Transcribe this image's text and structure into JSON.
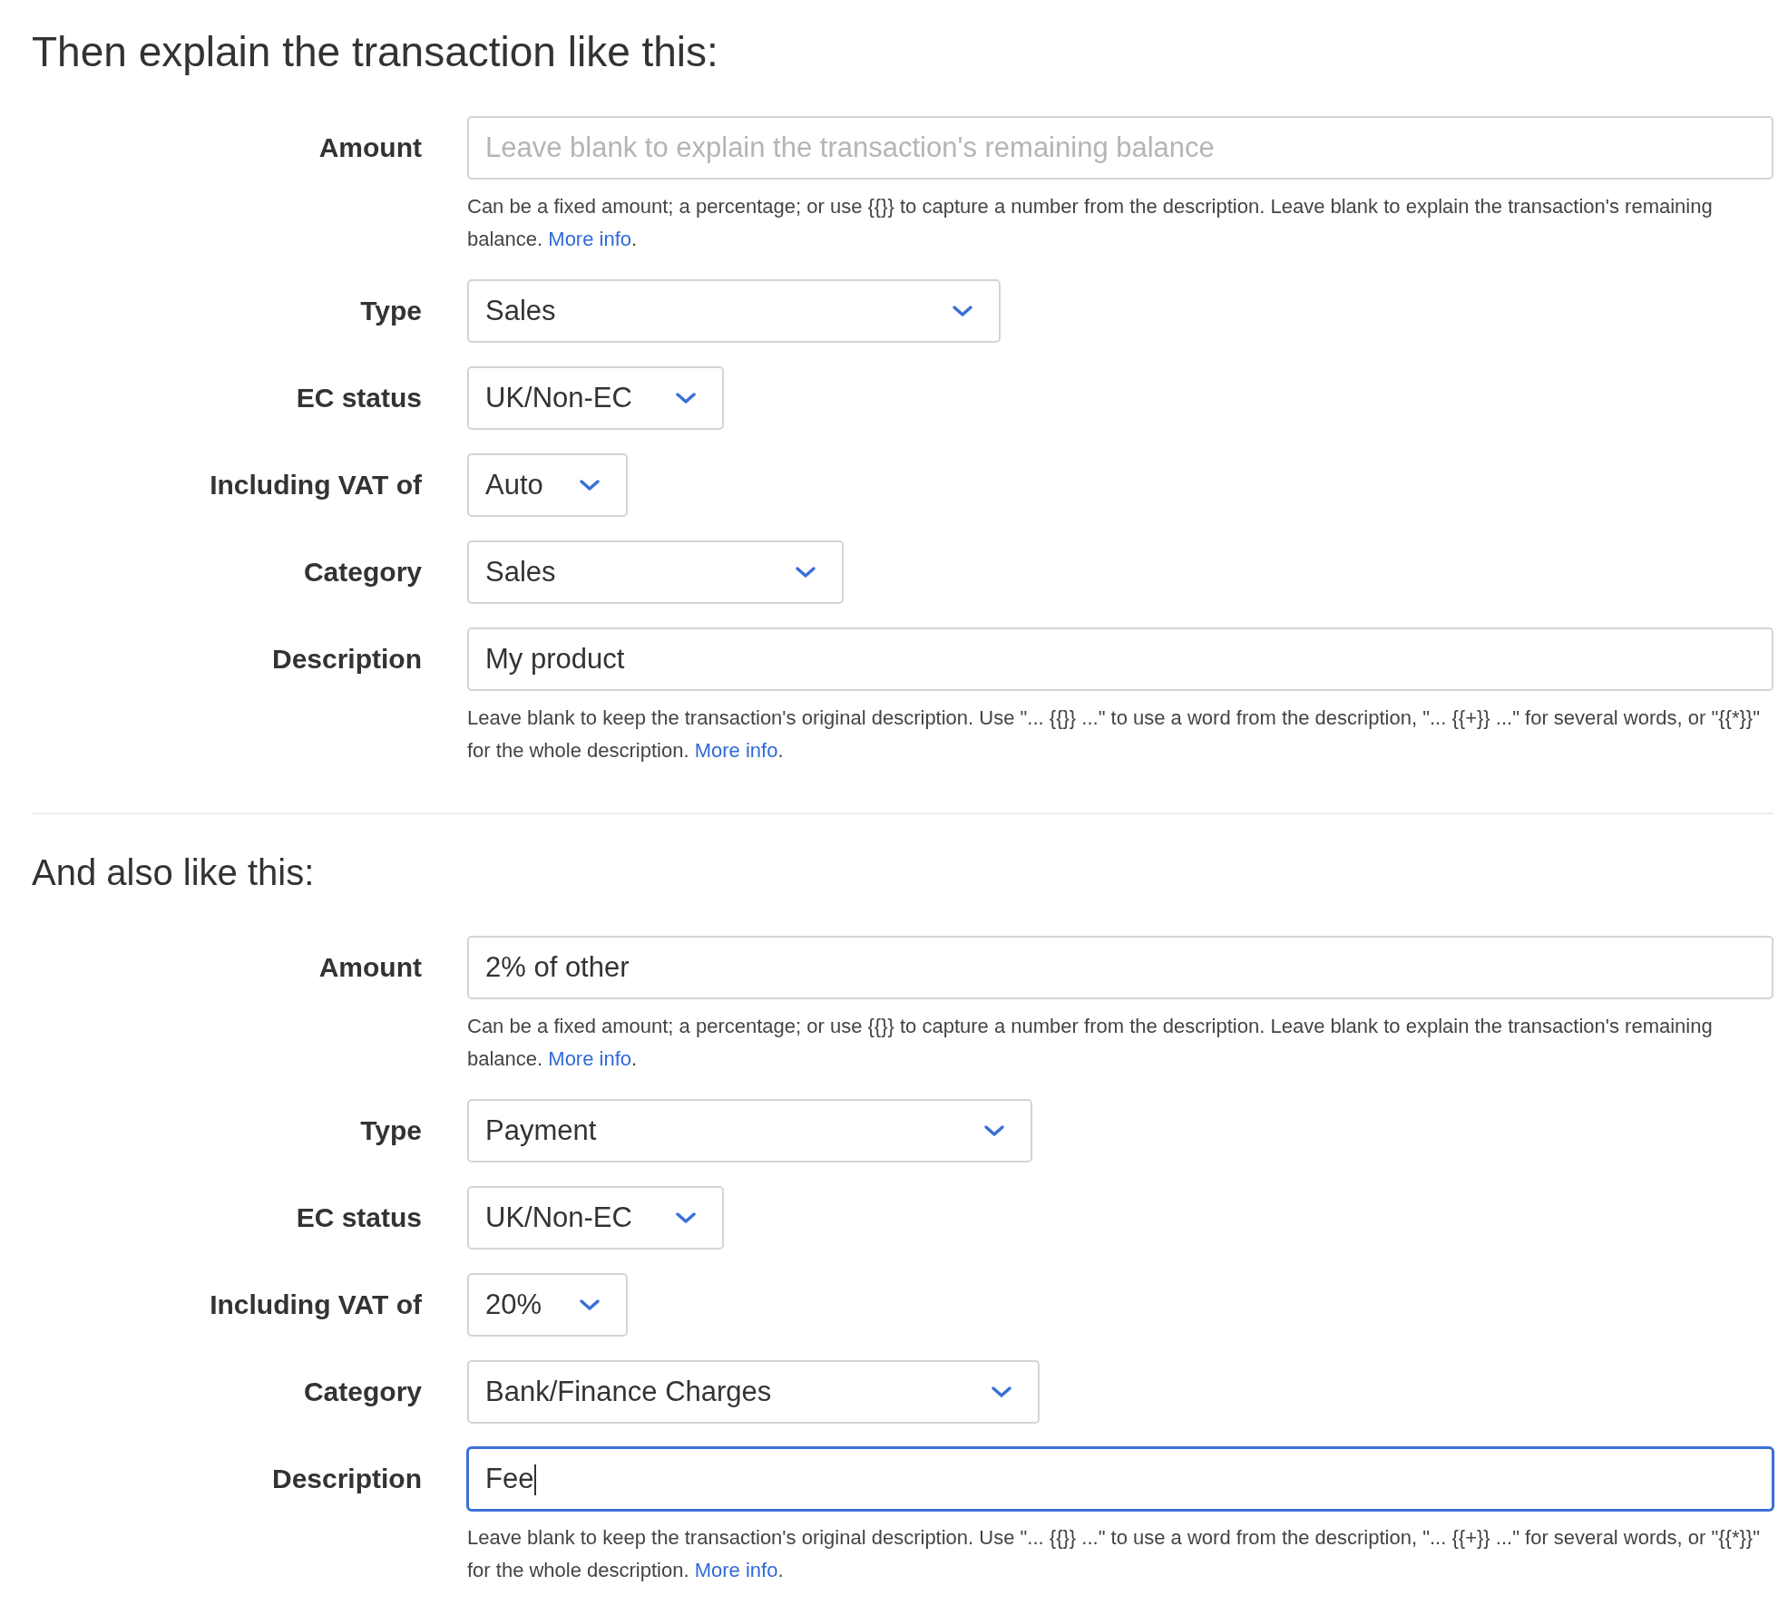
{
  "sections": [
    {
      "heading": "Then explain the transaction like this:",
      "fields": [
        {
          "kind": "input",
          "label": "Amount",
          "placeholder": "Leave blank to explain the transaction's remaining balance",
          "focused": false,
          "help": "Can be a fixed amount; a percentage; or use {{}} to capture a number from the description. Leave blank to explain the transaction's remaining balance.",
          "help_link": "More info",
          "help_end": "."
        },
        {
          "kind": "select",
          "label": "Type",
          "value": "Sales"
        },
        {
          "kind": "select",
          "label": "EC status",
          "value": "UK/Non-EC"
        },
        {
          "kind": "select",
          "label": "Including VAT of",
          "value": "Auto"
        },
        {
          "kind": "select",
          "label": "Category",
          "value": "Sales"
        },
        {
          "kind": "input",
          "label": "Description",
          "value": "My product",
          "focused": false,
          "help": "Leave blank to keep the transaction's original description. Use \"... {{}} ...\" to use a word from the description, \"... {{+}} ...\" for several words, or \"{{*}}\" for the whole description.",
          "help_link": "More info",
          "help_end": "."
        }
      ]
    },
    {
      "heading": "And also like this:",
      "fields": [
        {
          "kind": "input",
          "label": "Amount",
          "value": "2% of other",
          "focused": false,
          "help": "Can be a fixed amount; a percentage; or use {{}} to capture a number from the description. Leave blank to explain the transaction's remaining balance.",
          "help_link": "More info",
          "help_end": "."
        },
        {
          "kind": "select",
          "label": "Type",
          "value": "Payment"
        },
        {
          "kind": "select",
          "label": "EC status",
          "value": "UK/Non-EC"
        },
        {
          "kind": "select",
          "label": "Including VAT of",
          "value": "20%"
        },
        {
          "kind": "select",
          "label": "Category",
          "value": "Bank/Finance Charges"
        },
        {
          "kind": "input",
          "label": "Description",
          "value": "Fee",
          "focused": true,
          "help": "Leave blank to keep the transaction's original description. Use \"... {{}} ...\" to use a word from the description, \"... {{+}} ...\" for several words, or \"{{*}}\" for the whole description.",
          "help_link": "More info",
          "help_end": "."
        }
      ]
    }
  ]
}
